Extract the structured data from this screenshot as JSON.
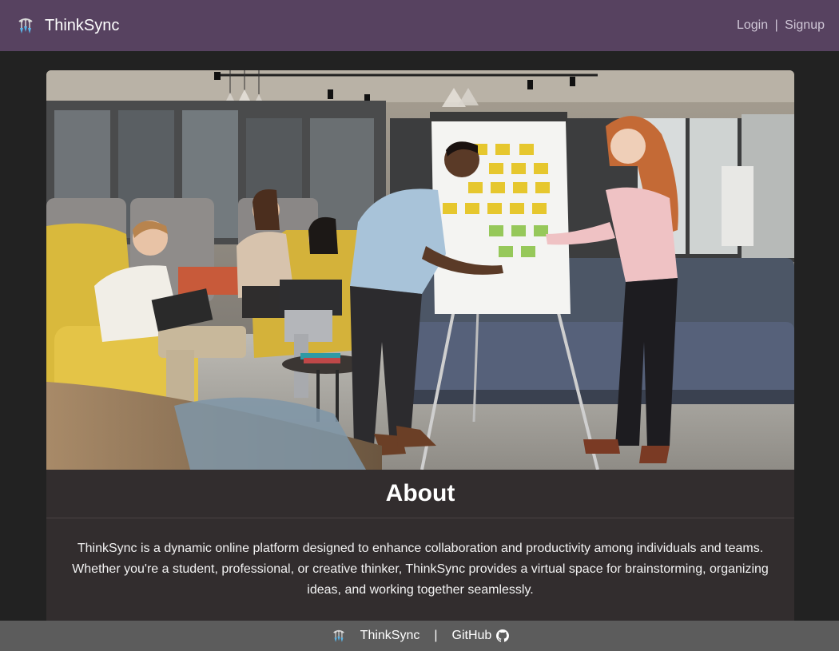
{
  "navbar": {
    "brand_name": "ThinkSync",
    "logo_icon": "brain-lightbulb-logo-icon",
    "login_label": "Login",
    "separator": "|",
    "signup_label": "Signup"
  },
  "hero": {
    "description": "team brainstorming at flip chart with sticky notes"
  },
  "about": {
    "title": "About",
    "text": "ThinkSync is a dynamic online platform designed to enhance collaboration and productivity among individuals and teams. Whether you're a student, professional, or creative thinker, ThinkSync provides a virtual space for brainstorming, organizing ideas, and working together seamlessly."
  },
  "footer": {
    "brand_name": "ThinkSync",
    "separator": "|",
    "github_label": "GitHub",
    "github_icon": "github-icon"
  },
  "colors": {
    "navbar_bg": "#574260",
    "page_bg": "#222222",
    "card_bg": "#322d2e",
    "footer_bg": "#5c5c5c",
    "logo_blue": "#5bb6e8"
  }
}
